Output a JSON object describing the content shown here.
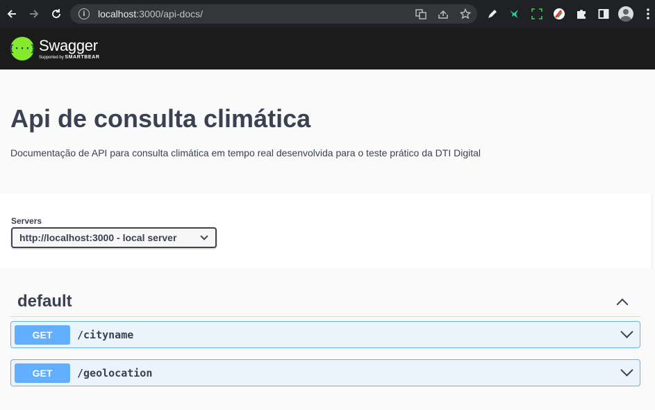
{
  "browser": {
    "url_host": "localhost",
    "url_rest": ":3000/api-docs/",
    "back_icon": "arrow-left-icon",
    "forward_icon": "arrow-right-icon",
    "reload_icon": "reload-icon"
  },
  "topbar": {
    "logo_glyph": "{···}",
    "brand": "Swagger",
    "supported_prefix": "Supported by ",
    "supported_brand": "SMARTBEAR"
  },
  "info": {
    "title": "Api de consulta climática",
    "description": "Documentação de API para consulta climática em tempo real desenvolvida para o teste prático da DTI Digital"
  },
  "servers": {
    "label": "Servers",
    "selected": "http://localhost:3000 - local server"
  },
  "operations": {
    "tag": "default",
    "items": [
      {
        "method": "GET",
        "path": "/cityname"
      },
      {
        "method": "GET",
        "path": "/geolocation"
      }
    ]
  },
  "colors": {
    "get_method": "#61affe",
    "swagger_green": "#85ea2d",
    "topbar_bg": "#1b1b1b"
  }
}
